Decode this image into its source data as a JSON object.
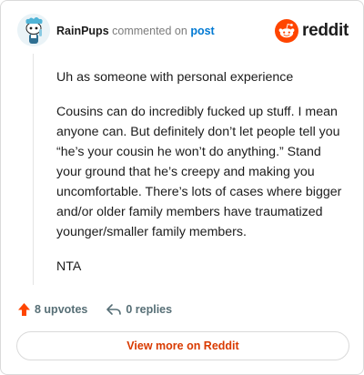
{
  "comment": {
    "username": "RainPups",
    "action_text": "commented on",
    "post_link": "post",
    "paragraphs": [
      "Uh as someone with personal experience",
      "Cousins can do incredibly fucked up stuff. I mean anyone can. But definitely don’t let people tell you “he’s your cousin he won’t do anything.” Stand your ground that he’s creepy and making you uncomfortable. There’s lots of cases where bigger and/or older family members have traumatized younger/smaller family members.",
      "NTA"
    ]
  },
  "brand": {
    "wordmark": "reddit",
    "accent_color": "#ff4500"
  },
  "actions": {
    "upvotes": "8 upvotes",
    "replies": "0 replies"
  },
  "footer": {
    "view_more": "View more on Reddit"
  },
  "icons": {
    "avatar": "snoo-avatar",
    "logo": "reddit-snoo-icon",
    "upvote": "upvote-arrow-icon",
    "reply": "reply-arrow-icon"
  }
}
